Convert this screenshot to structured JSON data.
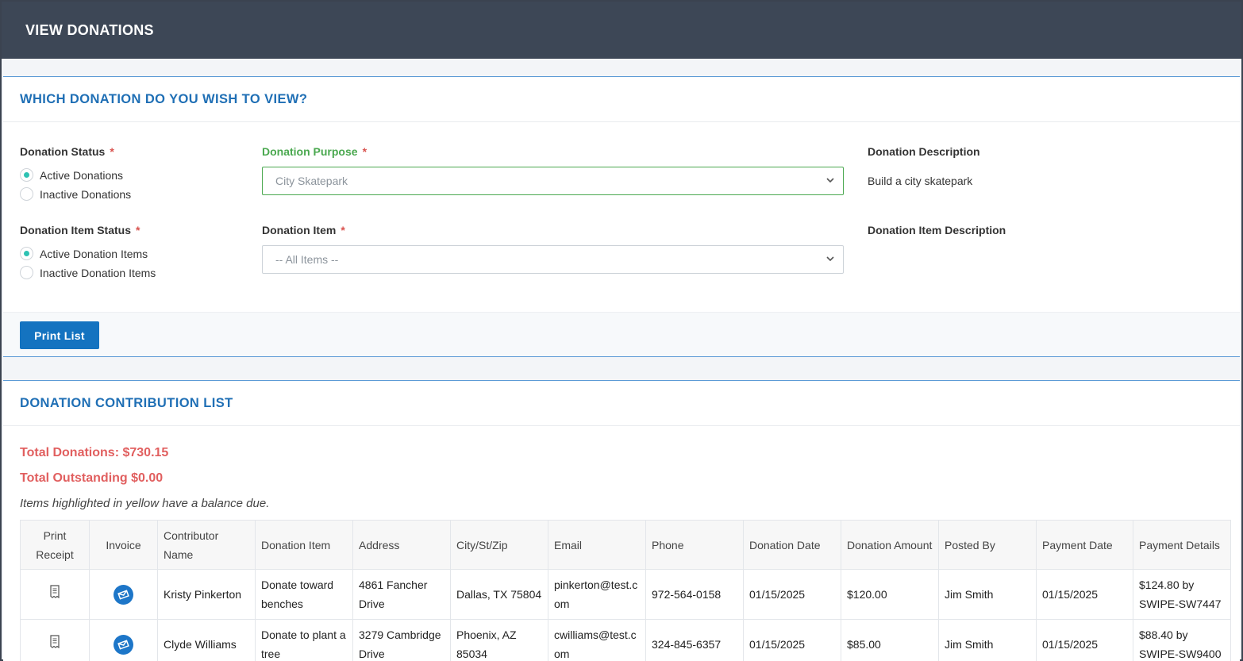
{
  "header": {
    "title": "VIEW DONATIONS"
  },
  "filter_panel": {
    "title": "WHICH DONATION DO YOU WISH TO VIEW?",
    "donation_status": {
      "label": "Donation Status",
      "options": [
        "Active Donations",
        "Inactive Donations"
      ],
      "selected": "Active Donations"
    },
    "donation_purpose": {
      "label": "Donation Purpose",
      "value": "City Skatepark"
    },
    "donation_description": {
      "label": "Donation Description",
      "value": "Build a city skatepark"
    },
    "item_status": {
      "label": "Donation Item Status",
      "options": [
        "Active Donation Items",
        "Inactive Donation Items"
      ],
      "selected": "Active Donation Items"
    },
    "donation_item": {
      "label": "Donation Item",
      "value": "-- All Items --"
    },
    "item_description": {
      "label": "Donation Item Description",
      "value": ""
    },
    "required_marker": "*",
    "print_button": "Print List"
  },
  "list_panel": {
    "title": "DONATION CONTRIBUTION LIST",
    "total_donations": "Total Donations: $730.15",
    "total_outstanding": "Total Outstanding $0.00",
    "note": "Items highlighted in yellow have a balance due.",
    "columns": [
      "Print Receipt",
      "Invoice",
      "Contributor Name",
      "Donation Item",
      "Address",
      "City/St/Zip",
      "Email",
      "Phone",
      "Donation Date",
      "Donation Amount",
      "Posted By",
      "Payment Date",
      "Payment Details"
    ],
    "rows": [
      {
        "name": "Kristy Pinkerton",
        "item": "Donate toward benches",
        "address": "4861 Fancher Drive",
        "city": "Dallas, TX 75804",
        "email": "pinkerton@test.com",
        "phone": "972-564-0158",
        "donation_date": "01/15/2025",
        "amount": "$120.00",
        "posted_by": "Jim Smith",
        "payment_date": "01/15/2025",
        "payment_details": "$124.80 by SWIPE-SW7447"
      },
      {
        "name": "Clyde Williams",
        "item": "Donate to plant a tree",
        "address": "3279 Cambridge Drive",
        "city": "Phoenix, AZ 85034",
        "email": "cwilliams@test.com",
        "phone": "324-845-6357",
        "donation_date": "01/15/2025",
        "amount": "$85.00",
        "posted_by": "Jim Smith",
        "payment_date": "01/15/2025",
        "payment_details": "$88.40 by SWIPE-SW9400"
      }
    ],
    "icons": {
      "receipt": "receipt-icon",
      "invoice": "email-invoice-icon"
    }
  },
  "colors": {
    "header_bg": "#3d4756",
    "accent": "#1f6fb5",
    "button": "#1473c0",
    "alert": "#e15f5f",
    "radio_on": "#2ec2b3"
  }
}
